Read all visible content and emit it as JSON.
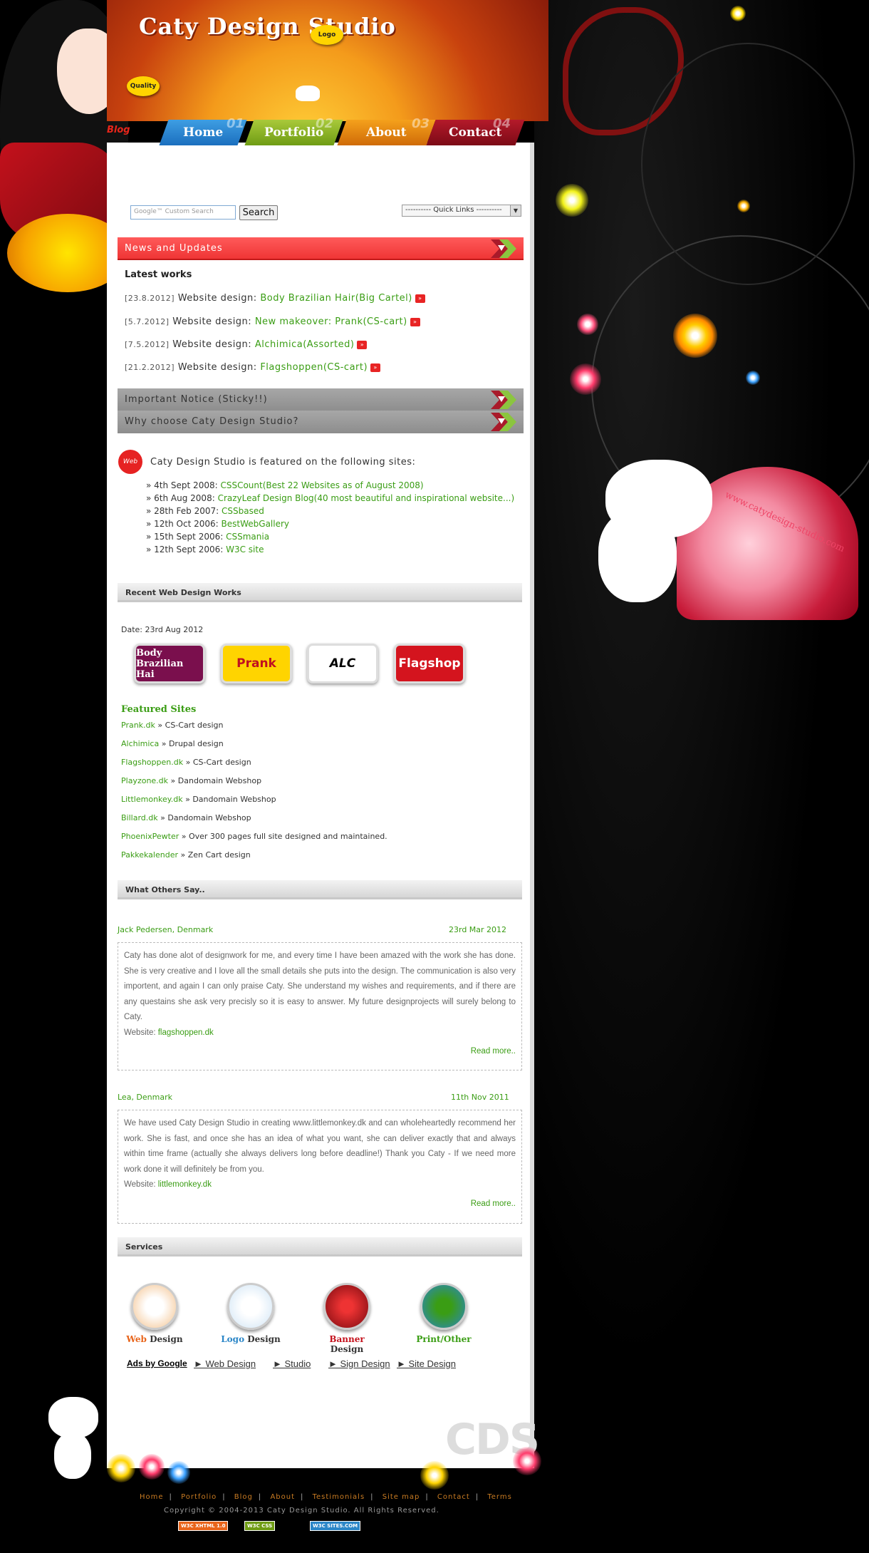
{
  "header": {
    "site_title": "Caty Design Studio",
    "badge_logo": "Logo",
    "badge_quality": "Quality"
  },
  "nav": {
    "blog": "Blog",
    "items": [
      {
        "label": "Home",
        "num": "01"
      },
      {
        "label": "Portfolio",
        "num": "02"
      },
      {
        "label": "About",
        "num": "03"
      },
      {
        "label": "Contact",
        "num": "04"
      }
    ]
  },
  "search": {
    "placeholder": "Custom Search",
    "button": "Search",
    "quick_links": "---------- Quick Links ----------"
  },
  "bars": {
    "news": "News and Updates",
    "notice": "Important Notice (Sticky!!)",
    "why": "Why choose Caty Design Studio?"
  },
  "latest": {
    "title": "Latest works",
    "items": [
      {
        "date": "[23.8.2012]",
        "text": "Website design:",
        "link": "Body Brazilian Hair(Big Cartel)"
      },
      {
        "date": "[5.7.2012]",
        "text": "Website design:",
        "link": "New makeover: Prank(CS-cart)"
      },
      {
        "date": "[7.5.2012]",
        "text": "Website design:",
        "link": "Alchimica(Assorted)"
      },
      {
        "date": "[21.2.2012]",
        "text": "Website design:",
        "link": "Flagshoppen(CS-cart)"
      }
    ]
  },
  "featured_on": {
    "badge": "Web",
    "title": "Caty Design Studio is featured on the following sites:",
    "items": [
      {
        "date": "» 4th Sept 2008:",
        "link": "CSSCount(Best 22 Websites as of August 2008)"
      },
      {
        "date": "» 6th Aug 2008:",
        "link": "CrazyLeaf Design Blog(40 most beautiful and inspirational website...)"
      },
      {
        "date": "» 28th Feb 2007:",
        "link": "CSSbased"
      },
      {
        "date": "» 12th Oct 2006:",
        "link": "BestWebGallery"
      },
      {
        "date": "» 15th Sept 2006:",
        "link": "CSSmania"
      },
      {
        "date": "» 12th Sept 2006:",
        "link": "W3C site"
      }
    ]
  },
  "recent": {
    "heading": "Recent Web Design Works",
    "date": "Date: 23rd Aug 2012",
    "thumbs": [
      "Body Brazilian Hai",
      "Prank",
      "ALC",
      "Flagshop"
    ]
  },
  "featured_sites": {
    "title": "Featured Sites",
    "items": [
      {
        "link": "Prank.dk",
        "desc": "» CS-Cart design"
      },
      {
        "link": "Alchimica",
        "desc": "» Drupal design"
      },
      {
        "link": "Flagshoppen.dk",
        "desc": "» CS-Cart design"
      },
      {
        "link": "Playzone.dk",
        "desc": "» Dandomain Webshop"
      },
      {
        "link": "Littlemonkey.dk",
        "desc": "» Dandomain Webshop"
      },
      {
        "link": "Billard.dk",
        "desc": "» Dandomain Webshop"
      },
      {
        "link": "PhoenixPewter",
        "desc": "» Over 300 pages full site designed and maintained."
      },
      {
        "link": "Pakkekalender",
        "desc": "» Zen Cart design"
      }
    ]
  },
  "testimonials": {
    "heading": "What Others Say..",
    "items": [
      {
        "name": "Jack Pedersen, Denmark",
        "date": "23rd Mar 2012",
        "text": "Caty has done alot of designwork for me, and every time I have been amazed with the work she has done. She is very creative and I love all the small details she puts into the design. The communication is also very importent, and again I can only praise Caty. She understand my wishes and requirements, and if there are any questains she ask very precisly so it is easy to answer. My future designprojects will surely belong to Caty.",
        "website_label": "Website:",
        "website": "flagshoppen.dk",
        "read_more": "Read more.."
      },
      {
        "name": "Lea, Denmark",
        "date": "11th Nov 2011",
        "text": "We have used Caty Design Studio in creating www.littlemonkey.dk and can wholeheartedly recommend her work. She is fast, and once she has an idea of what you want, she can deliver exactly that and always within time frame (actually she always delivers long before deadline!) Thank you Caty - If we need more work done it will definitely be from you.",
        "website_label": "Website:",
        "website": "littlemonkey.dk",
        "read_more": "Read more.."
      }
    ]
  },
  "services": {
    "heading": "Services",
    "items": [
      {
        "accent": "Web",
        "rest": "Design",
        "color": "#e8641a"
      },
      {
        "accent": "Logo",
        "rest": "Design",
        "color": "#2b86c7"
      },
      {
        "accent": "Banner",
        "rest": "Design",
        "color": "#c4111c"
      },
      {
        "accent": "Print/Other",
        "rest": "",
        "color": "#3a9d14"
      }
    ]
  },
  "ads": {
    "label": "Ads by Google",
    "links": [
      "► Web Design",
      "► Studio",
      "► Sign Design",
      "► Site Design"
    ]
  },
  "watermark": "CDS",
  "dome_text": "www.catydesign-studio.com",
  "footer": {
    "links": [
      "Home",
      "Portfolio",
      "Blog",
      "About",
      "Testimonials",
      "Site map",
      "Contact",
      "Terms"
    ],
    "copyright": "Copyright © 2004-2013 Caty Design Studio. All Rights Reserved.",
    "badges": [
      "W3C XHTML 1.0",
      "W3C CSS",
      "W3C SITES.COM"
    ]
  },
  "colors": {
    "accent_green": "#3a9d14",
    "bar_red": "#ef3535",
    "header_orange": "#f49b1b"
  }
}
